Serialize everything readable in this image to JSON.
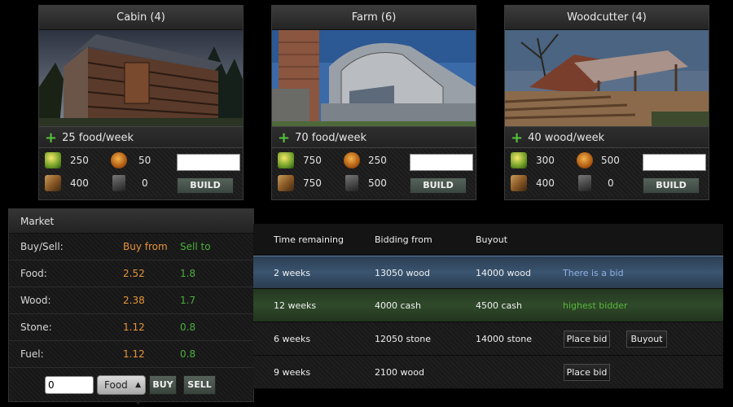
{
  "buildings": [
    {
      "title": "Cabin (4)",
      "produce": "25 food/week",
      "cost_food": "250",
      "cost_wood": "50",
      "cost_stone": "400",
      "cost_fuel": "0",
      "build_label": "BUILD"
    },
    {
      "title": "Farm (6)",
      "produce": "70 food/week",
      "cost_food": "750",
      "cost_wood": "250",
      "cost_stone": "750",
      "cost_fuel": "500",
      "build_label": "BUILD"
    },
    {
      "title": "Woodcutter (4)",
      "produce": "40 wood/week",
      "cost_food": "300",
      "cost_wood": "500",
      "cost_stone": "400",
      "cost_fuel": "0",
      "build_label": "BUILD"
    }
  ],
  "market": {
    "title": "Market",
    "header": {
      "label": "Buy/Sell:",
      "buy": "Buy from",
      "sell": "Sell to"
    },
    "rows": [
      {
        "label": "Food:",
        "buy": "2.52",
        "sell": "1.8"
      },
      {
        "label": "Wood:",
        "buy": "2.38",
        "sell": "1.7"
      },
      {
        "label": "Stone:",
        "buy": "1.12",
        "sell": "0.8"
      },
      {
        "label": "Fuel:",
        "buy": "1.12",
        "sell": "0.8"
      }
    ],
    "quantity_value": "0",
    "resource_selected": "Food",
    "buy_label": "BUY",
    "sell_label": "SELL"
  },
  "auction": {
    "headers": {
      "time": "Time remaining",
      "bidding": "Bidding from",
      "buyout": "Buyout"
    },
    "rows": [
      {
        "time": "2 weeks",
        "bidding": "13050 wood",
        "buyout": "14000 wood",
        "status": "There is a bid"
      },
      {
        "time": "12 weeks",
        "bidding": "4000 cash",
        "buyout": "4500 cash",
        "status": "highest bidder"
      },
      {
        "time": "6 weeks",
        "bidding": "12050 stone",
        "buyout": "14000 stone",
        "bid_label": "Place bid",
        "buyout_label": "Buyout"
      },
      {
        "time": "9 weeks",
        "bidding": "2100 wood",
        "bid_label": "Place bid"
      }
    ]
  },
  "colors": {
    "buy": "#e6953a",
    "sell": "#4cae3d",
    "plus": "#55c43b",
    "highlight_blue": "#3a5470",
    "highlight_green": "#2f4a2a"
  },
  "icons": [
    "food-icon",
    "wood-icon",
    "stone-icon",
    "fuel-icon",
    "plus-icon",
    "dropdown-arrow-icon"
  ]
}
